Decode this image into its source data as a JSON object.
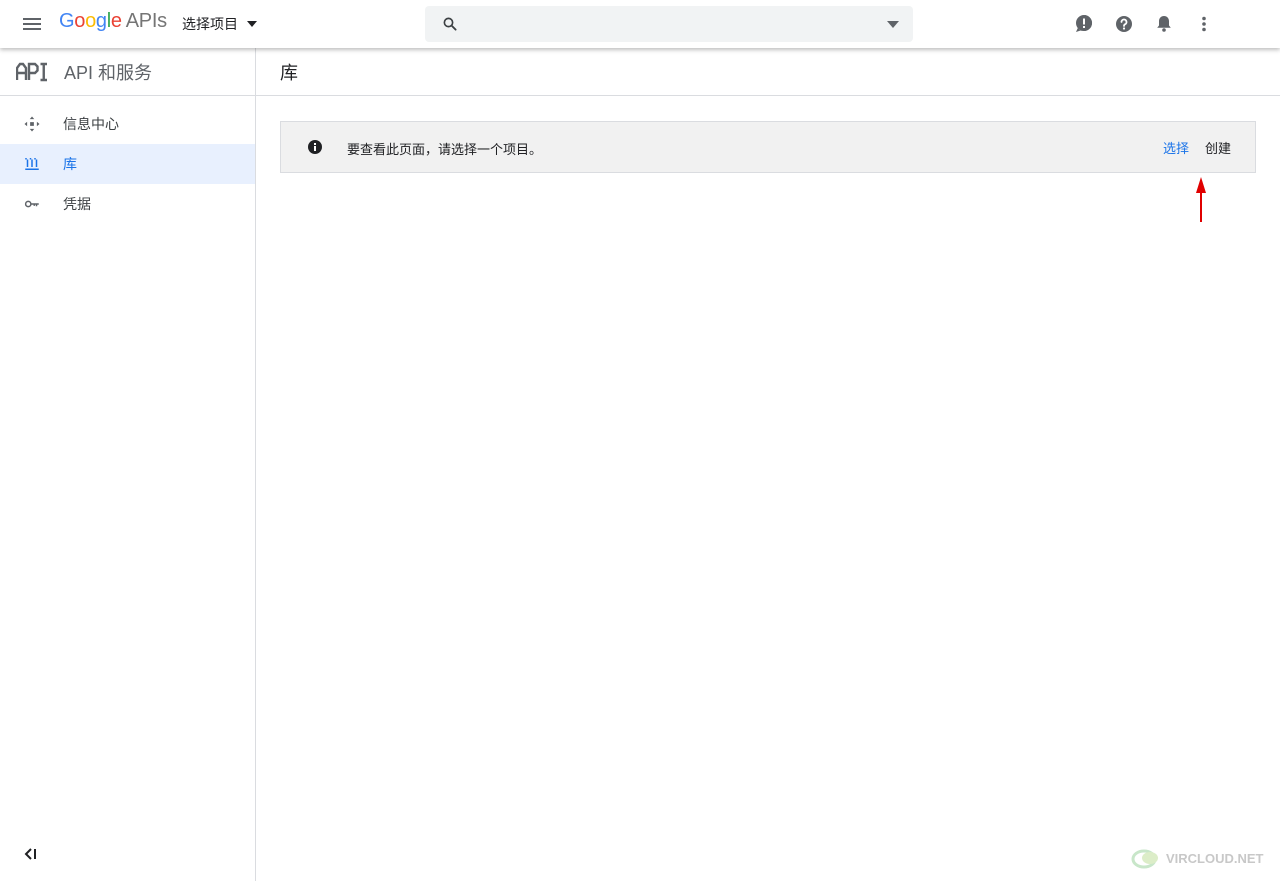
{
  "topbar": {
    "logo": {
      "g1": "G",
      "g2": "o",
      "g3": "o",
      "g4": "g",
      "g5": "l",
      "g6": "e",
      "apis": "APIs"
    },
    "project_label": "选择项目",
    "search": {
      "value": "",
      "placeholder": ""
    },
    "icons": [
      "menu-icon",
      "search-icon",
      "feedback-icon",
      "help-icon",
      "notifications-icon",
      "more-vert-icon"
    ]
  },
  "sidebar": {
    "title": "API 和服务",
    "items": [
      {
        "label": "信息中心",
        "icon": "dashboard-icon",
        "active": false
      },
      {
        "label": "库",
        "icon": "library-icon",
        "active": true
      },
      {
        "label": "凭据",
        "icon": "key-icon",
        "active": false
      }
    ]
  },
  "main": {
    "title": "库",
    "notice": {
      "message": "要查看此页面，请选择一个项目。",
      "select_label": "选择",
      "create_label": "创建"
    }
  },
  "watermark": {
    "text": "VIRCLOUD.NET"
  },
  "colors": {
    "accent": "#1a73e8",
    "active_bg": "#e8f0fe",
    "annotation_arrow": "#e00000"
  }
}
